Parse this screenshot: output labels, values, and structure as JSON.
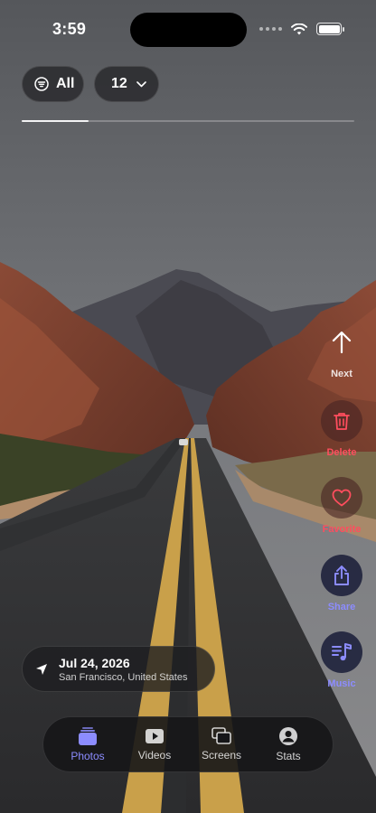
{
  "status_bar": {
    "time": "3:59"
  },
  "filters": {
    "all_label": "All",
    "count_label": "12"
  },
  "viewer": {
    "progress": 0.2
  },
  "actions": [
    {
      "label": "Next",
      "icon": "arrow-up-icon",
      "color": "#ffffff"
    },
    {
      "label": "Delete",
      "icon": "trash-icon",
      "color": "#ff4d5e"
    },
    {
      "label": "Favorite",
      "icon": "heart-icon",
      "color": "#ff4d5e"
    },
    {
      "label": "Share",
      "icon": "share-icon",
      "color": "#8c8cff"
    },
    {
      "label": "Music",
      "icon": "music-note-icon",
      "color": "#8c8cff"
    }
  ],
  "location": {
    "date": "Jul 24, 2026",
    "place": "San Francisco, United States"
  },
  "tabs": [
    {
      "label": "Photos",
      "icon": "photos-icon",
      "active": true
    },
    {
      "label": "Videos",
      "icon": "play-icon",
      "active": false
    },
    {
      "label": "Screens",
      "icon": "screens-icon",
      "active": false
    },
    {
      "label": "Stats",
      "icon": "person-icon",
      "active": false
    }
  ],
  "colors": {
    "accent": "#8c8cff",
    "danger": "#ff4d5e"
  }
}
